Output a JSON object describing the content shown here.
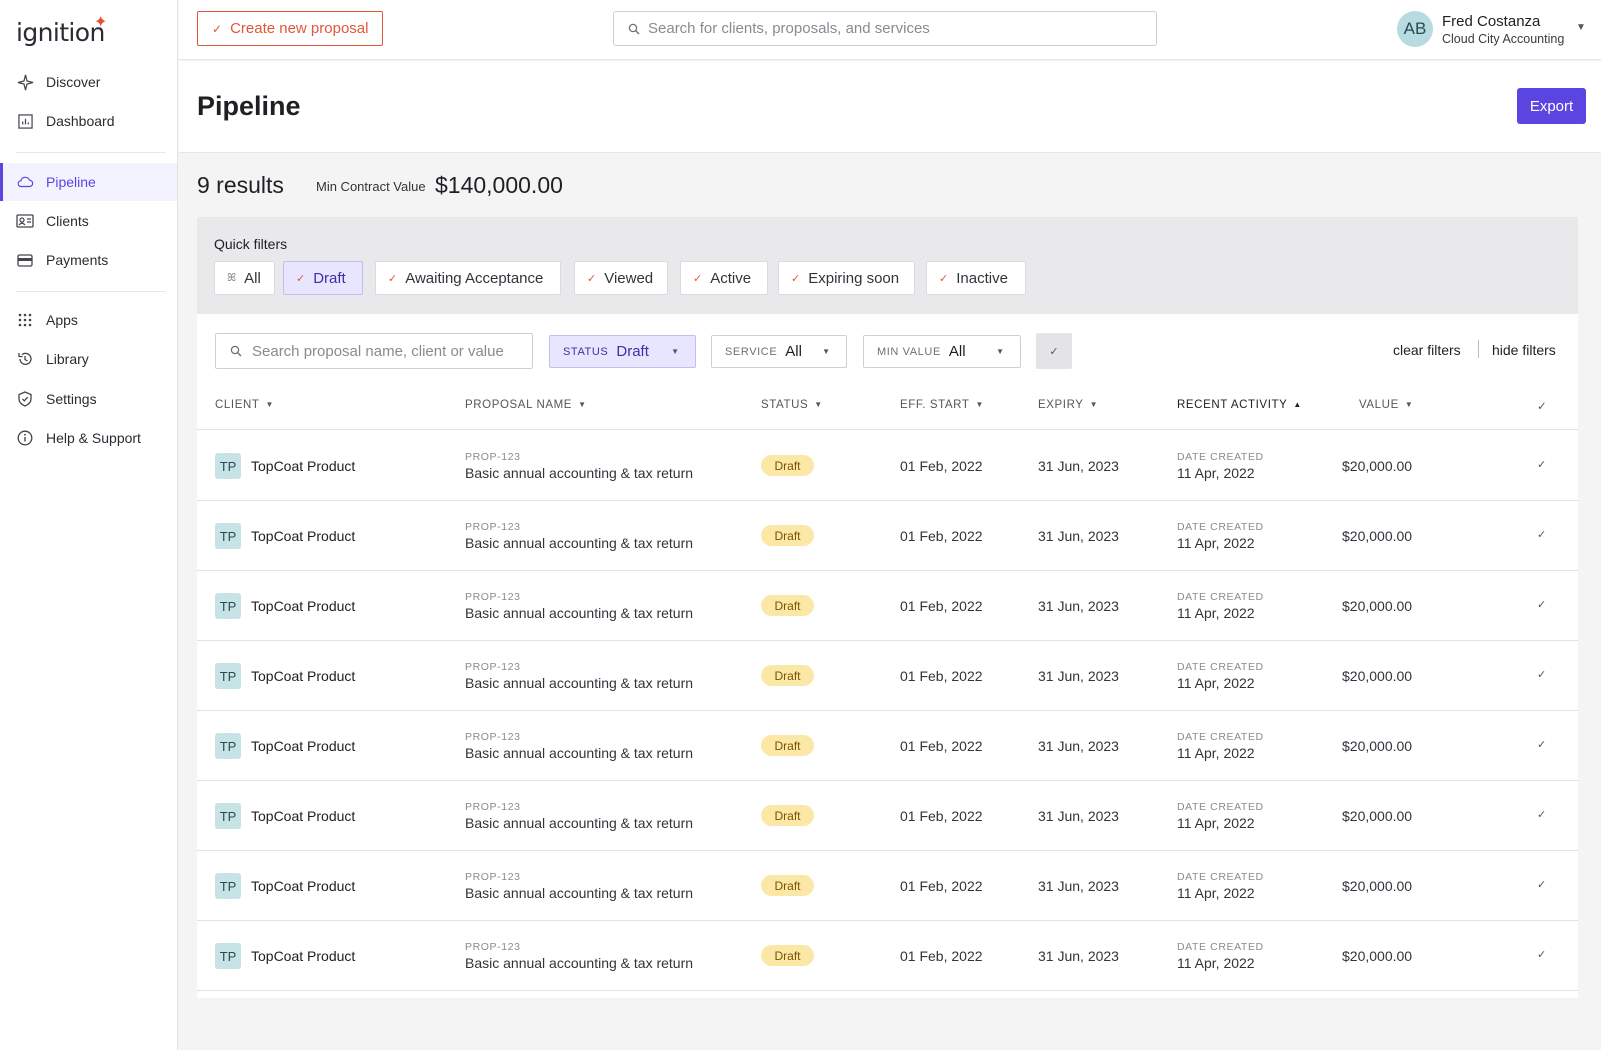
{
  "brand": {
    "name": "ignition",
    "accent": "#5b45e0",
    "alert": "#e2573a"
  },
  "sidebar": {
    "items": [
      {
        "label": "Discover",
        "icon": "sparkle-icon"
      },
      {
        "label": "Dashboard",
        "icon": "chart-icon"
      },
      {
        "label": "Pipeline",
        "icon": "cloud-icon",
        "active": true
      },
      {
        "label": "Clients",
        "icon": "id-card-icon"
      },
      {
        "label": "Payments",
        "icon": "wallet-icon"
      },
      {
        "label": "Apps",
        "icon": "grid-icon"
      },
      {
        "label": "Library",
        "icon": "history-icon"
      },
      {
        "label": "Settings",
        "icon": "shield-icon"
      },
      {
        "label": "Help & Support",
        "icon": "info-icon"
      }
    ]
  },
  "topbar": {
    "create_label": "Create new proposal",
    "search_placeholder": "Search for clients, proposals, and services",
    "user": {
      "initials": "AB",
      "name": "Fred Costanza",
      "org": "Cloud City Accounting"
    }
  },
  "page": {
    "title": "Pipeline",
    "export_label": "Export",
    "results": "9 results",
    "min_contract_label": "Min Contract Value",
    "min_contract_value": "$140,000.00"
  },
  "quick_filters": {
    "title": "Quick filters",
    "chips": [
      {
        "label": "All",
        "selected": false
      },
      {
        "label": "Draft",
        "selected": true
      },
      {
        "label": "Awaiting Acceptance",
        "selected": false
      },
      {
        "label": "Viewed",
        "selected": false
      },
      {
        "label": "Active",
        "selected": false
      },
      {
        "label": "Expiring soon",
        "selected": false
      },
      {
        "label": "Inactive",
        "selected": false
      }
    ]
  },
  "filters": {
    "search_placeholder": "Search proposal name, client or value",
    "status": {
      "label": "STATUS",
      "value": "Draft"
    },
    "service": {
      "label": "SERVICE",
      "value": "All"
    },
    "min_value": {
      "label": "MIN VALUE",
      "value": "All"
    },
    "clear_label": "clear filters",
    "hide_label": "hide filters"
  },
  "table": {
    "columns": [
      "CLIENT",
      "PROPOSAL NAME",
      "STATUS",
      "EFF. START",
      "EXPIRY",
      "RECENT ACTIVITY",
      "VALUE"
    ],
    "sorted_column": "RECENT ACTIVITY",
    "rows": [
      {
        "initials": "TP",
        "client": "TopCoat Product",
        "prop_id": "PROP-123",
        "proposal": "Basic annual accounting & tax return",
        "status": "Draft",
        "start": "01 Feb, 2022",
        "expiry": "31 Jun, 2023",
        "activity_label": "DATE CREATED",
        "activity_date": "11 Apr, 2022",
        "value": "$20,000.00"
      },
      {
        "initials": "TP",
        "client": "TopCoat Product",
        "prop_id": "PROP-123",
        "proposal": "Basic annual accounting & tax return",
        "status": "Draft",
        "start": "01 Feb, 2022",
        "expiry": "31 Jun, 2023",
        "activity_label": "DATE CREATED",
        "activity_date": "11 Apr, 2022",
        "value": "$20,000.00"
      },
      {
        "initials": "TP",
        "client": "TopCoat Product",
        "prop_id": "PROP-123",
        "proposal": "Basic annual accounting & tax return",
        "status": "Draft",
        "start": "01 Feb, 2022",
        "expiry": "31 Jun, 2023",
        "activity_label": "DATE CREATED",
        "activity_date": "11 Apr, 2022",
        "value": "$20,000.00"
      },
      {
        "initials": "TP",
        "client": "TopCoat Product",
        "prop_id": "PROP-123",
        "proposal": "Basic annual accounting & tax return",
        "status": "Draft",
        "start": "01 Feb, 2022",
        "expiry": "31 Jun, 2023",
        "activity_label": "DATE CREATED",
        "activity_date": "11 Apr, 2022",
        "value": "$20,000.00"
      },
      {
        "initials": "TP",
        "client": "TopCoat Product",
        "prop_id": "PROP-123",
        "proposal": "Basic annual accounting & tax return",
        "status": "Draft",
        "start": "01 Feb, 2022",
        "expiry": "31 Jun, 2023",
        "activity_label": "DATE CREATED",
        "activity_date": "11 Apr, 2022",
        "value": "$20,000.00"
      },
      {
        "initials": "TP",
        "client": "TopCoat Product",
        "prop_id": "PROP-123",
        "proposal": "Basic annual accounting & tax return",
        "status": "Draft",
        "start": "01 Feb, 2022",
        "expiry": "31 Jun, 2023",
        "activity_label": "DATE CREATED",
        "activity_date": "11 Apr, 2022",
        "value": "$20,000.00"
      },
      {
        "initials": "TP",
        "client": "TopCoat Product",
        "prop_id": "PROP-123",
        "proposal": "Basic annual accounting & tax return",
        "status": "Draft",
        "start": "01 Feb, 2022",
        "expiry": "31 Jun, 2023",
        "activity_label": "DATE CREATED",
        "activity_date": "11 Apr, 2022",
        "value": "$20,000.00"
      },
      {
        "initials": "TP",
        "client": "TopCoat Product",
        "prop_id": "PROP-123",
        "proposal": "Basic annual accounting & tax return",
        "status": "Draft",
        "start": "01 Feb, 2022",
        "expiry": "31 Jun, 2023",
        "activity_label": "DATE CREATED",
        "activity_date": "11 Apr, 2022",
        "value": "$20,000.00"
      }
    ]
  }
}
